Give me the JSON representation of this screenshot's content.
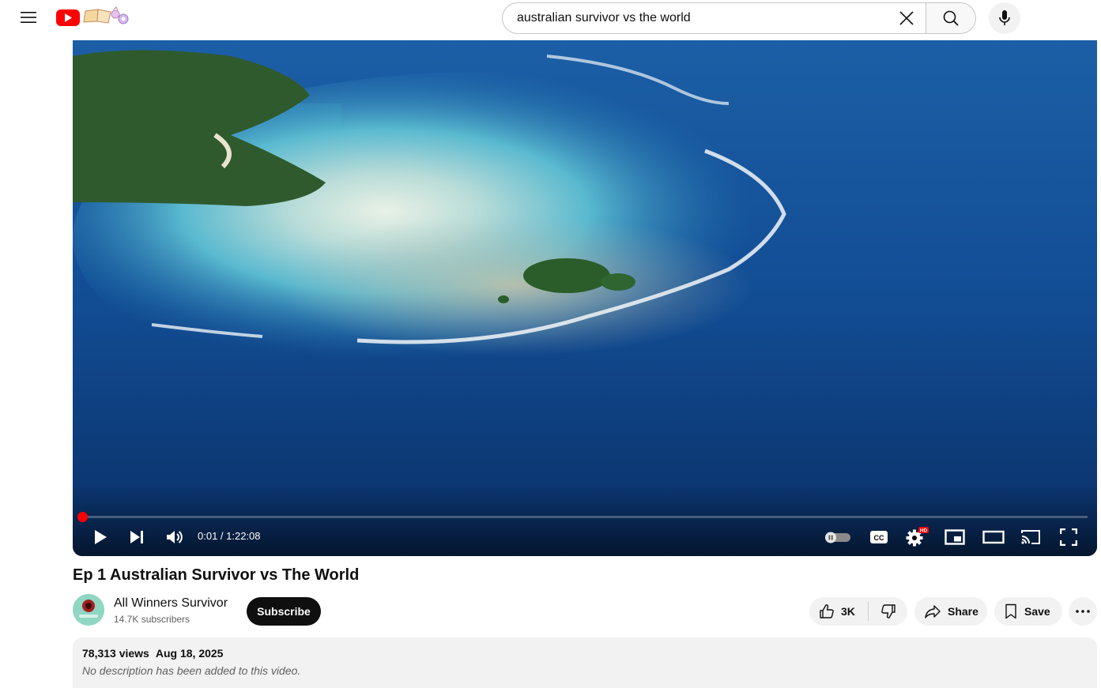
{
  "header": {
    "search": {
      "value": "australian survivor vs the world",
      "placeholder": "Search"
    },
    "icons": {
      "menu": "hamburger-menu-icon",
      "logo": "youtube-logo",
      "clear": "close-icon",
      "search": "search-icon",
      "mic": "microphone-icon"
    }
  },
  "player": {
    "current_time": "0:01",
    "duration": "1:22:08",
    "time_display": "0:01 / 1:22:08",
    "progress_fraction": 0.0002,
    "hd_badge": "HD",
    "cc_label": "CC",
    "colors": {
      "progress": "#ff0000",
      "ocean_deep": "#0a3a78",
      "ocean_shallow": "#5fc3d6"
    }
  },
  "video": {
    "title": "Ep 1 Australian Survivor vs The World",
    "channel": {
      "name": "All Winners Survivor",
      "subscribers": "14.7K subscribers",
      "subscribe_label": "Subscribe"
    },
    "actions": {
      "likes": "3K",
      "share_label": "Share",
      "save_label": "Save"
    },
    "description": {
      "views": "78,313 views",
      "date": "Aug 18, 2025",
      "text": "No description has been added to this video."
    }
  }
}
